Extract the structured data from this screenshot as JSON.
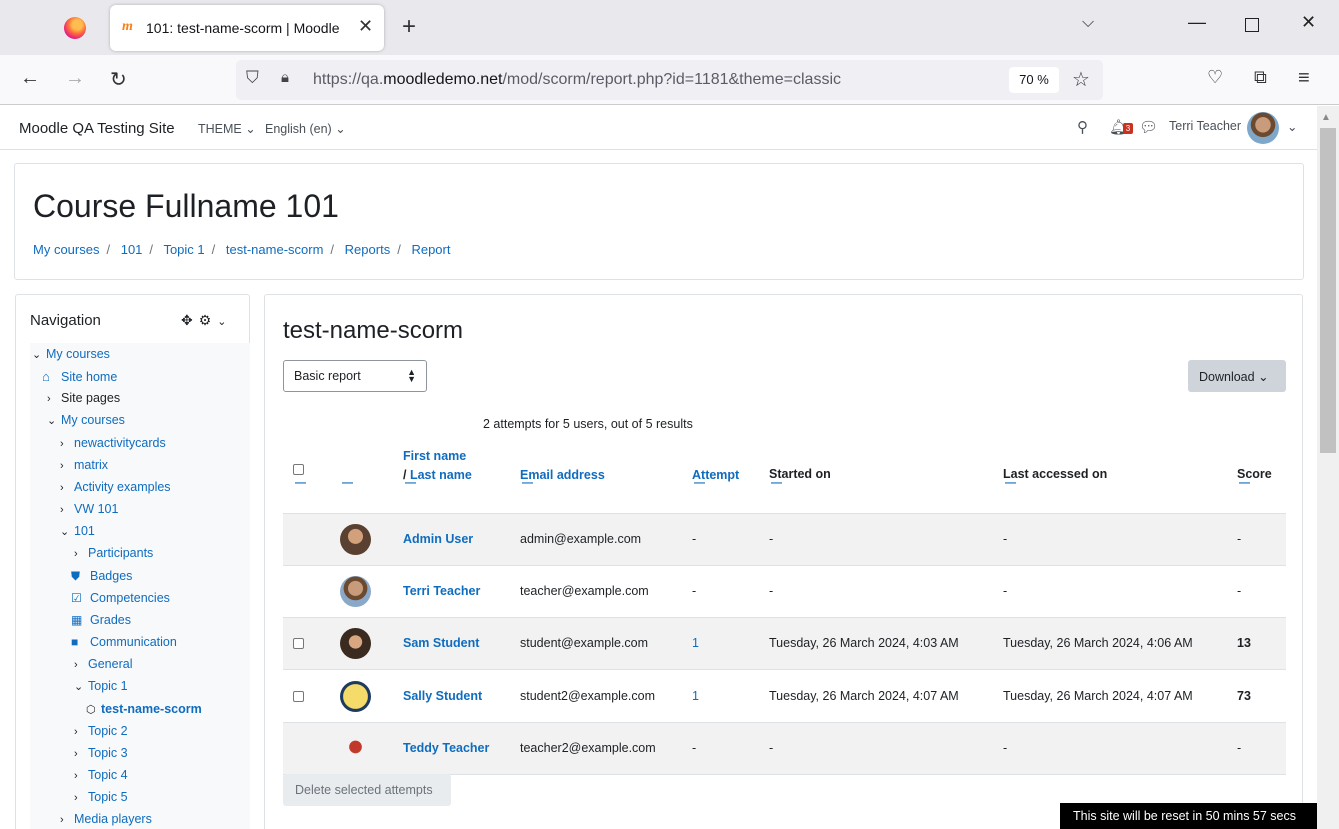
{
  "browser": {
    "tab_title": "101: test-name-scorm | Moodle",
    "tab_favicon": "moodle-icon",
    "url_prefix": "https://qa.",
    "url_domain": "moodledemo.net",
    "url_path": "/mod/scorm/report.php?id=1181&theme=classic",
    "zoom": "70 %"
  },
  "header": {
    "site_name": "Moodle QA Testing Site",
    "theme_menu": "THEME",
    "language_menu": "English (en)",
    "notification_count": "3",
    "user_name": "Terri Teacher"
  },
  "course": {
    "title": "Course Fullname 101",
    "breadcrumb": [
      "My courses",
      "101",
      "Topic 1",
      "test-name-scorm",
      "Reports",
      "Report"
    ]
  },
  "navigation": {
    "title": "Navigation",
    "items": [
      {
        "label": "My courses",
        "icon": "chevron-down-icon"
      },
      {
        "label": "Site home",
        "icon": "home-icon"
      },
      {
        "label": "Site pages",
        "icon": "chevron-right-icon"
      },
      {
        "label": "My courses",
        "icon": "chevron-down-icon"
      },
      {
        "label": "newactivitycards",
        "icon": "chevron-right-icon"
      },
      {
        "label": "matrix",
        "icon": "chevron-right-icon"
      },
      {
        "label": "Activity examples",
        "icon": "chevron-right-icon"
      },
      {
        "label": "VW 101",
        "icon": "chevron-right-icon"
      },
      {
        "label": "101",
        "icon": "chevron-down-icon"
      },
      {
        "label": "Participants",
        "icon": "chevron-right-icon"
      },
      {
        "label": "Badges",
        "icon": "shield-icon"
      },
      {
        "label": "Competencies",
        "icon": "checkbox-icon"
      },
      {
        "label": "Grades",
        "icon": "table-icon"
      },
      {
        "label": "Communication",
        "icon": "square-icon"
      },
      {
        "label": "General",
        "icon": "chevron-right-icon"
      },
      {
        "label": "Topic 1",
        "icon": "chevron-down-icon"
      },
      {
        "label": "test-name-scorm",
        "icon": "package-icon"
      },
      {
        "label": "Topic 2",
        "icon": "chevron-right-icon"
      },
      {
        "label": "Topic 3",
        "icon": "chevron-right-icon"
      },
      {
        "label": "Topic 4",
        "icon": "chevron-right-icon"
      },
      {
        "label": "Topic 5",
        "icon": "chevron-right-icon"
      },
      {
        "label": "Media players",
        "icon": "chevron-right-icon"
      }
    ]
  },
  "report": {
    "title": "test-name-scorm",
    "report_type": "Basic report",
    "download_label": "Download",
    "summary": "2 attempts for 5 users, out of 5 results",
    "headers": {
      "first_name": "First name",
      "slash": "/ ",
      "last_name": "Last name",
      "email": "Email address",
      "attempt": "Attempt",
      "started_on": "Started on",
      "last_accessed": "Last accessed on",
      "score": "Score"
    },
    "rows": [
      {
        "name": "Admin User",
        "email": "admin@example.com",
        "attempt": "-",
        "started": "-",
        "last": "-",
        "score": "-",
        "checkbox": false,
        "avatar_color": "#5a4030"
      },
      {
        "name": "Terri Teacher",
        "email": "teacher@example.com",
        "attempt": "-",
        "started": "-",
        "last": "-",
        "score": "-",
        "checkbox": false,
        "avatar_color": "#8aa9c9"
      },
      {
        "name": "Sam Student",
        "email": "student@example.com",
        "attempt": "1",
        "started": "Tuesday, 26 March 2024, 4:03 AM",
        "last": "Tuesday, 26 March 2024, 4:06 AM",
        "score": "13",
        "checkbox": true,
        "avatar_color": "#3a2a20"
      },
      {
        "name": "Sally Student",
        "email": "student2@example.com",
        "attempt": "1",
        "started": "Tuesday, 26 March 2024, 4:07 AM",
        "last": "Tuesday, 26 March 2024, 4:07 AM",
        "score": "73",
        "checkbox": true,
        "avatar_color": "#f2d04a"
      },
      {
        "name": "Teddy Teacher",
        "email": "teacher2@example.com",
        "attempt": "-",
        "started": "-",
        "last": "-",
        "score": "-",
        "checkbox": false,
        "avatar_color": "#c0392b"
      }
    ],
    "delete_label": "Delete selected attempts"
  },
  "reset_banner": "This site will be reset in 50 mins 57 secs"
}
